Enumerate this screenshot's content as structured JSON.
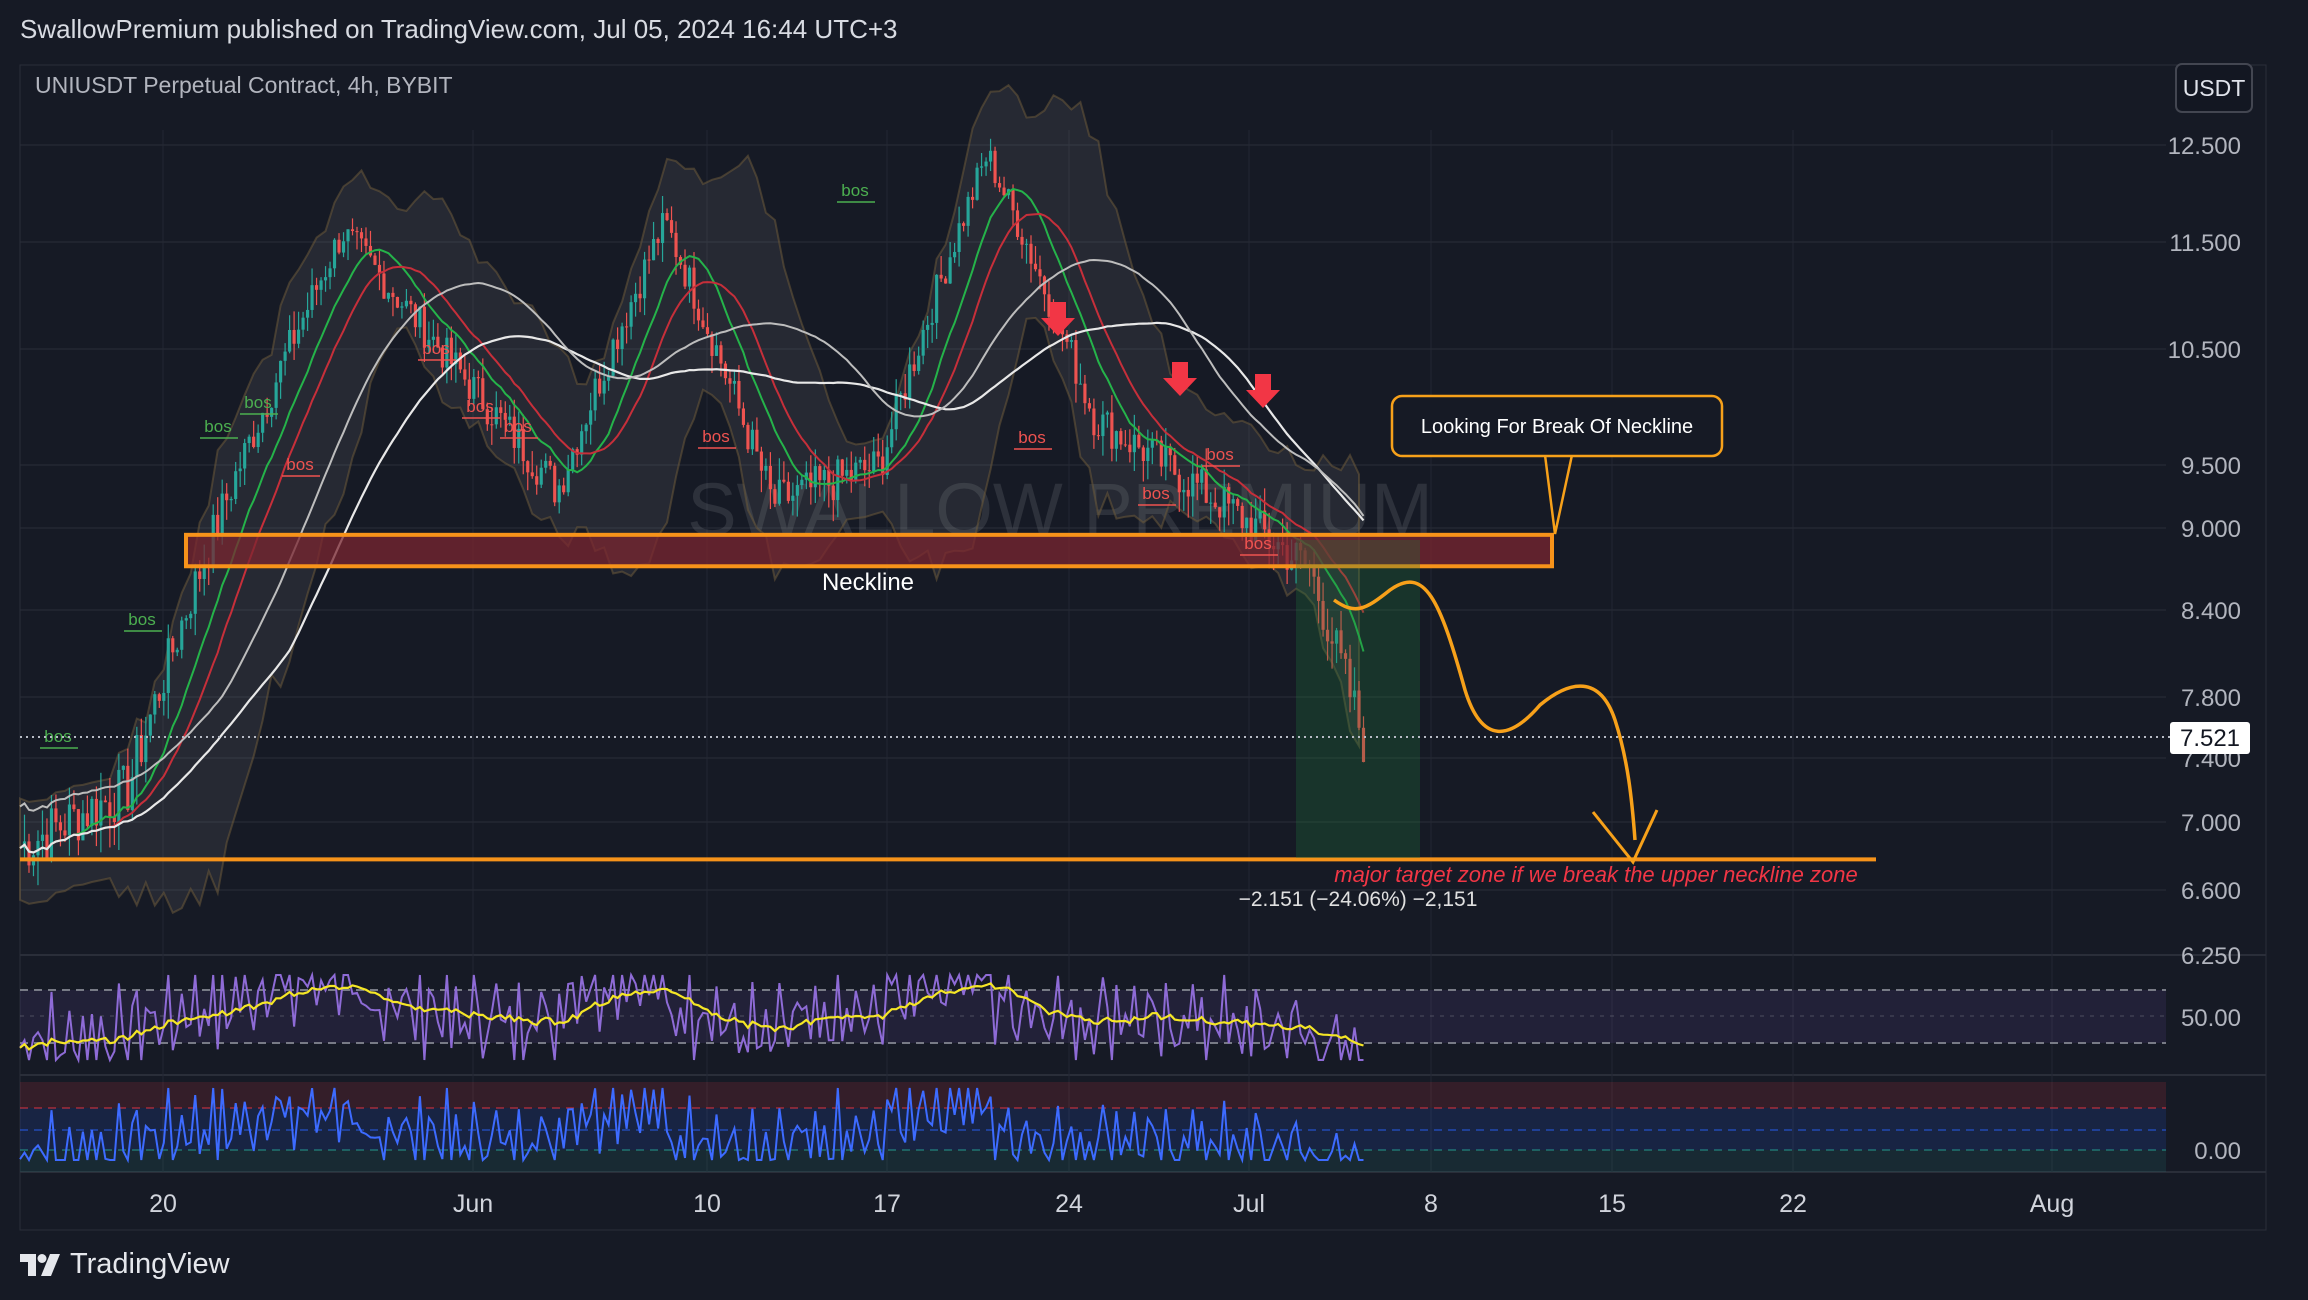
{
  "header": {
    "published": "SwallowPremium published on TradingView.com, Jul 05, 2024 16:44 UTC+3"
  },
  "chart": {
    "symbol_line": "UNIUSDT Perpetual Contract, 4h, BYBIT",
    "currency_button": "USDT",
    "watermark": "SWALLOW PREMIUM",
    "last_price": "7.521",
    "price_ticks": [
      "12.500",
      "11.500",
      "10.500",
      "9.500",
      "9.000",
      "8.400",
      "7.800",
      "7.400",
      "7.000",
      "6.600",
      "6.250"
    ],
    "rsi_tick": "50.00",
    "osc_tick": "0.00",
    "time_ticks": [
      "20",
      "Jun",
      "10",
      "17",
      "24",
      "Jul",
      "8",
      "15",
      "22",
      "Aug"
    ],
    "annotations": {
      "callout": "Looking For Break Of Neckline",
      "neckline_label": "Neckline",
      "target_note": "major target zone if we break the upper neckline zone",
      "measure": "−2.151 (−24.06%) −2,151",
      "bos_label": "bos"
    },
    "colors": {
      "background": "#161a25",
      "up_candle": "#26a69a",
      "down_candle": "#ef5350",
      "zone": "#f7931a",
      "arrow": "#f23645",
      "rsi": "#8e6bd6",
      "rsi_ma": "#f5e626",
      "osc": "#3d6bff"
    }
  },
  "branding": {
    "logo_text": "TradingView"
  },
  "chart_data": {
    "type": "line",
    "x": [
      20,
      40,
      60,
      80,
      100,
      120,
      140,
      160,
      180,
      200,
      220,
      240,
      260,
      270
    ],
    "series": [
      {
        "values": [
          6.85,
          7.2,
          9.4,
          11.6,
          10.4,
          9.3,
          11.7,
          9.2,
          9.5,
          12.4,
          9.9,
          9.3,
          8.7,
          7.52
        ]
      }
    ],
    "ylim": [
      6.25,
      12.8
    ],
    "zones": [
      {
        "from": 8.72,
        "to": 8.95
      }
    ],
    "levels": [
      6.78
    ],
    "markers": {
      "bos": 14,
      "down_arrows": 3
    }
  }
}
